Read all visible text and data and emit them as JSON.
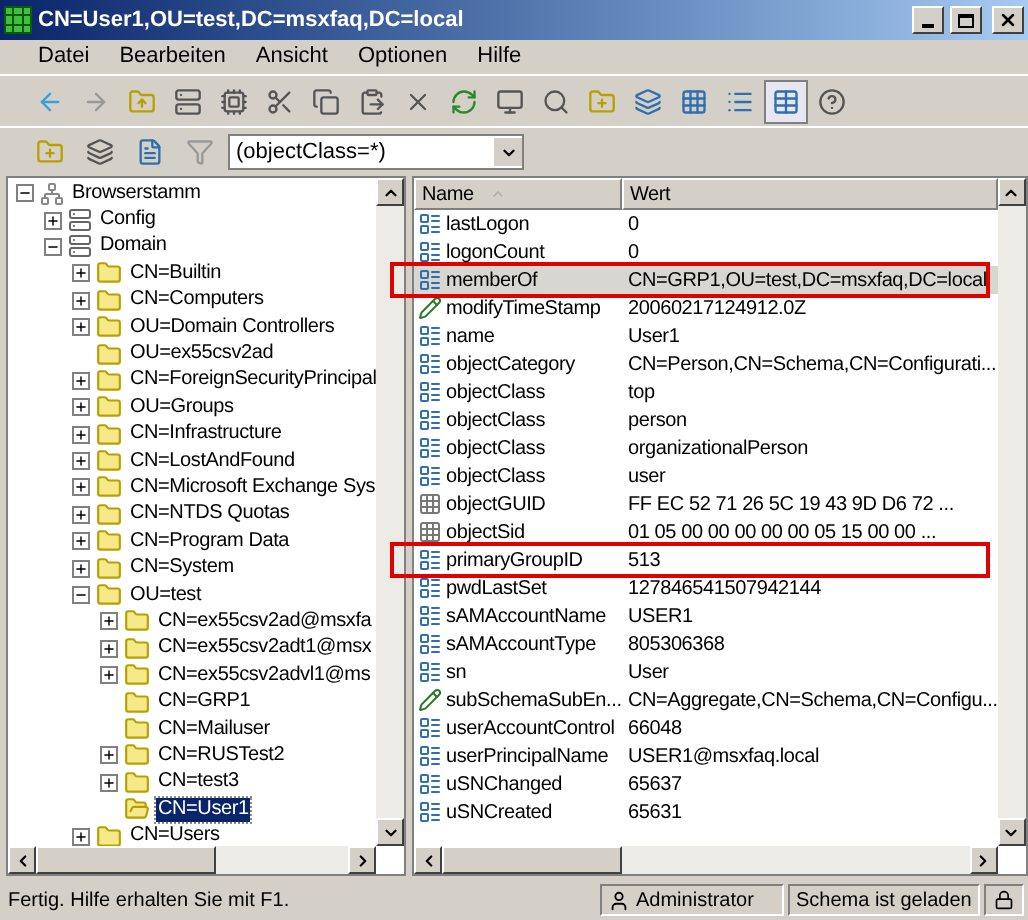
{
  "window": {
    "title": "CN=User1,OU=test,DC=msxfaq,DC=local"
  },
  "menu": [
    "Datei",
    "Bearbeiten",
    "Ansicht",
    "Optionen",
    "Hilfe"
  ],
  "filter": {
    "value": "(objectClass=*)"
  },
  "tree": [
    {
      "label": "Browserstamm",
      "kind": "root",
      "expanded": true,
      "selected": false,
      "children": [
        {
          "label": "Config",
          "kind": "server",
          "expanded": false,
          "selected": false
        },
        {
          "label": "Domain",
          "kind": "server",
          "expanded": true,
          "selected": false,
          "children": [
            {
              "label": "CN=Builtin",
              "kind": "folder",
              "expanded": false,
              "selected": false
            },
            {
              "label": "CN=Computers",
              "kind": "folder",
              "expanded": false,
              "selected": false
            },
            {
              "label": "OU=Domain Controllers",
              "kind": "folder",
              "expanded": false,
              "selected": false
            },
            {
              "label": "OU=ex55csv2ad",
              "kind": "folder",
              "selected": false
            },
            {
              "label": "CN=ForeignSecurityPrincipal",
              "kind": "folder",
              "expanded": false,
              "selected": false
            },
            {
              "label": "OU=Groups",
              "kind": "folder",
              "expanded": false,
              "selected": false
            },
            {
              "label": "CN=Infrastructure",
              "kind": "folder",
              "expanded": false,
              "selected": false
            },
            {
              "label": "CN=LostAndFound",
              "kind": "folder",
              "expanded": false,
              "selected": false
            },
            {
              "label": "CN=Microsoft Exchange Sys",
              "kind": "folder",
              "expanded": false,
              "selected": false
            },
            {
              "label": "CN=NTDS Quotas",
              "kind": "folder",
              "expanded": false,
              "selected": false
            },
            {
              "label": "CN=Program Data",
              "kind": "folder",
              "expanded": false,
              "selected": false
            },
            {
              "label": "CN=System",
              "kind": "folder",
              "expanded": false,
              "selected": false
            },
            {
              "label": "OU=test",
              "kind": "folder",
              "expanded": true,
              "selected": false,
              "children": [
                {
                  "label": "CN=ex55csv2ad@msxfa",
                  "kind": "folder",
                  "expanded": false,
                  "selected": false
                },
                {
                  "label": "CN=ex55csv2adt1@msx",
                  "kind": "folder",
                  "expanded": false,
                  "selected": false
                },
                {
                  "label": "CN=ex55csv2advl1@ms",
                  "kind": "folder",
                  "expanded": false,
                  "selected": false
                },
                {
                  "label": "CN=GRP1",
                  "kind": "folder",
                  "selected": false
                },
                {
                  "label": "CN=Mailuser",
                  "kind": "folder",
                  "selected": false
                },
                {
                  "label": "CN=RUSTest2",
                  "kind": "folder",
                  "expanded": false,
                  "selected": false
                },
                {
                  "label": "CN=test3",
                  "kind": "folder",
                  "expanded": false,
                  "selected": false
                },
                {
                  "label": "CN=User1",
                  "kind": "folder",
                  "selected": true
                }
              ]
            },
            {
              "label": "CN=Users",
              "kind": "folder",
              "expanded": false,
              "selected": false
            }
          ]
        }
      ]
    }
  ],
  "list": {
    "columns": [
      "Name",
      "Wert"
    ],
    "rows": [
      {
        "name": "lastLogon",
        "value": "0",
        "kind": "text",
        "selected": false,
        "highlighted": false
      },
      {
        "name": "logonCount",
        "value": "0",
        "kind": "text",
        "selected": false,
        "highlighted": false
      },
      {
        "name": "memberOf",
        "value": "CN=GRP1,OU=test,DC=msxfaq,DC=local",
        "kind": "text",
        "selected": true,
        "highlighted": true
      },
      {
        "name": "modifyTimeStamp",
        "value": "20060217124912.0Z",
        "kind": "time",
        "selected": false,
        "highlighted": false
      },
      {
        "name": "name",
        "value": "User1",
        "kind": "text",
        "selected": false,
        "highlighted": false
      },
      {
        "name": "objectCategory",
        "value": "CN=Person,CN=Schema,CN=Configurati...",
        "kind": "text",
        "selected": false,
        "highlighted": false
      },
      {
        "name": "objectClass",
        "value": "top",
        "kind": "text",
        "selected": false,
        "highlighted": false
      },
      {
        "name": "objectClass",
        "value": "person",
        "kind": "text",
        "selected": false,
        "highlighted": false
      },
      {
        "name": "objectClass",
        "value": "organizationalPerson",
        "kind": "text",
        "selected": false,
        "highlighted": false
      },
      {
        "name": "objectClass",
        "value": "user",
        "kind": "text",
        "selected": false,
        "highlighted": false
      },
      {
        "name": "objectGUID",
        "value": "FF EC 52 71 26 5C 19 43 9D D6 72 ...",
        "kind": "binary",
        "selected": false,
        "highlighted": false
      },
      {
        "name": "objectSid",
        "value": "01 05 00 00 00 00 00 05 15 00 00 ...",
        "kind": "binary",
        "selected": false,
        "highlighted": false
      },
      {
        "name": "primaryGroupID",
        "value": "513",
        "kind": "text",
        "selected": false,
        "highlighted": true
      },
      {
        "name": "pwdLastSet",
        "value": "127846541507942144",
        "kind": "text",
        "selected": false,
        "highlighted": false
      },
      {
        "name": "sAMAccountName",
        "value": "USER1",
        "kind": "text",
        "selected": false,
        "highlighted": false
      },
      {
        "name": "sAMAccountType",
        "value": "805306368",
        "kind": "text",
        "selected": false,
        "highlighted": false
      },
      {
        "name": "sn",
        "value": "User",
        "kind": "text",
        "selected": false,
        "highlighted": false
      },
      {
        "name": "subSchemaSubEn...",
        "value": "CN=Aggregate,CN=Schema,CN=Configu...",
        "kind": "time",
        "selected": false,
        "highlighted": false
      },
      {
        "name": "userAccountControl",
        "value": "66048",
        "kind": "text",
        "selected": false,
        "highlighted": false
      },
      {
        "name": "userPrincipalName",
        "value": "USER1@msxfaq.local",
        "kind": "text",
        "selected": false,
        "highlighted": false
      },
      {
        "name": "uSNChanged",
        "value": "65637",
        "kind": "text",
        "selected": false,
        "highlighted": false
      },
      {
        "name": "uSNCreated",
        "value": "65631",
        "kind": "text",
        "selected": false,
        "highlighted": false
      }
    ]
  },
  "status_bar": {
    "message": "Fertig. Hilfe erhalten Sie mit F1.",
    "user": "Administrator",
    "schema": "Schema ist geladen"
  }
}
